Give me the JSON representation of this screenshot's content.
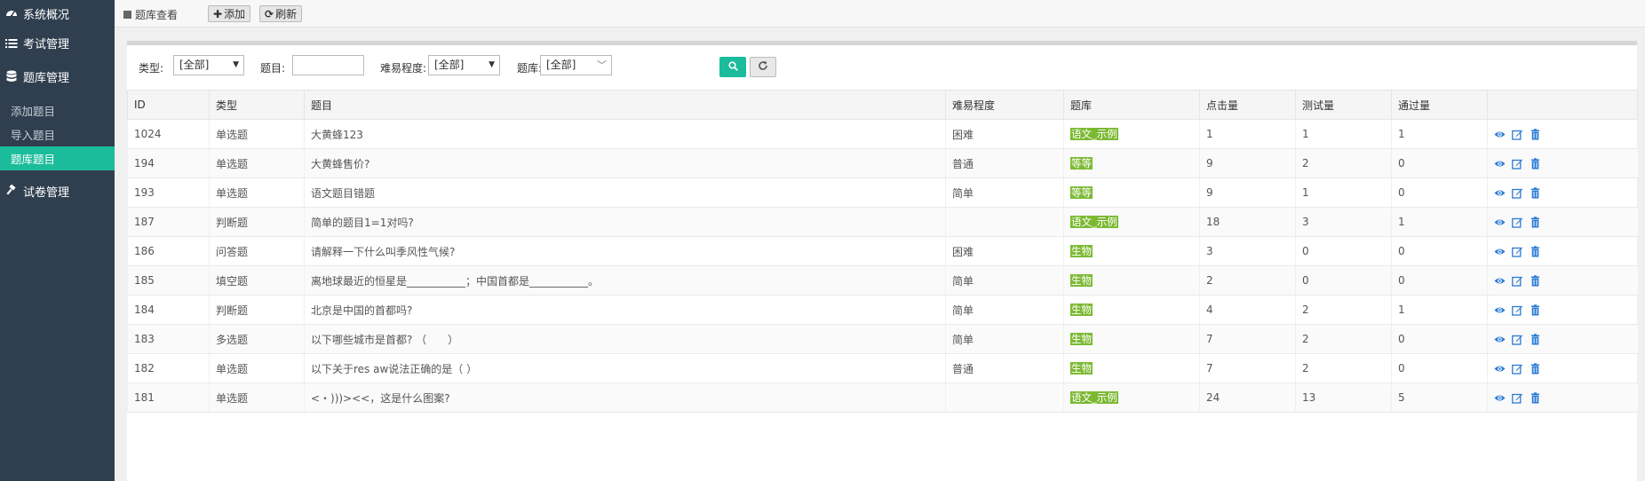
{
  "sidebar": {
    "items": [
      {
        "label": "系统概况",
        "icon": "dashboard-icon"
      },
      {
        "label": "考试管理",
        "icon": "list-icon"
      },
      {
        "label": "题库管理",
        "icon": "database-icon"
      },
      {
        "label": "试卷管理",
        "icon": "gavel-icon"
      }
    ],
    "sub_items": [
      {
        "label": "添加题目",
        "active": false
      },
      {
        "label": "导入题目",
        "active": false
      },
      {
        "label": "题库题目",
        "active": true
      }
    ],
    "background": "#2f3f4f",
    "accent": "#1bbc9b"
  },
  "topbar": {
    "breadcrumb": "题库查看",
    "add_label": "添加",
    "refresh_label": "刷新"
  },
  "filter": {
    "type_label": "类型:",
    "type_value": "[全部]",
    "title_label": "题目:",
    "title_value": "",
    "difficulty_label": "难易程度:",
    "difficulty_value": "[全部]",
    "bank_label": "题库:",
    "bank_value": "[全部]"
  },
  "table": {
    "headers": [
      "ID",
      "类型",
      "题目",
      "难易程度",
      "题库",
      "点击量",
      "测试量",
      "通过量",
      ""
    ],
    "rows": [
      {
        "id": "1024",
        "type": "单选题",
        "title": "大黄蜂123",
        "difficulty": "困难",
        "bank": "语文_示例",
        "clicks": "1",
        "tests": "1",
        "passes": "1"
      },
      {
        "id": "194",
        "type": "单选题",
        "title": "大黄蜂售价?",
        "difficulty": "普通",
        "bank": "等等",
        "clicks": "9",
        "tests": "2",
        "passes": "0"
      },
      {
        "id": "193",
        "type": "单选题",
        "title": "语文题目错题",
        "difficulty": "简单",
        "bank": "等等",
        "clicks": "9",
        "tests": "1",
        "passes": "0"
      },
      {
        "id": "187",
        "type": "判断题",
        "title": "简单的题目1=1对吗?",
        "difficulty": "",
        "bank": "语文_示例",
        "clicks": "18",
        "tests": "3",
        "passes": "1"
      },
      {
        "id": "186",
        "type": "问答题",
        "title": "请解释一下什么叫季风性气候?",
        "difficulty": "困难",
        "bank": "生物",
        "clicks": "3",
        "tests": "0",
        "passes": "0"
      },
      {
        "id": "185",
        "type": "填空题",
        "title": "离地球最近的恒星是___________；中国首都是___________。",
        "difficulty": "简单",
        "bank": "生物",
        "clicks": "2",
        "tests": "0",
        "passes": "0"
      },
      {
        "id": "184",
        "type": "判断题",
        "title": "北京是中国的首都吗?",
        "difficulty": "简单",
        "bank": "生物",
        "clicks": "4",
        "tests": "2",
        "passes": "1"
      },
      {
        "id": "183",
        "type": "多选题",
        "title": "以下哪些城市是首都? （　　）",
        "difficulty": "简单",
        "bank": "生物",
        "clicks": "7",
        "tests": "2",
        "passes": "0"
      },
      {
        "id": "182",
        "type": "单选题",
        "title": "以下关于res aw说法正确的是（ ）",
        "difficulty": "普通",
        "bank": "生物",
        "clicks": "7",
        "tests": "2",
        "passes": "0"
      },
      {
        "id": "181",
        "type": "单选题",
        "title": "<・)))><<，这是什么图案?",
        "difficulty": "",
        "bank": "语文_示例",
        "clicks": "24",
        "tests": "13",
        "passes": "5"
      }
    ],
    "tag_color": "#7cb933",
    "action_color": "#2a7bd4"
  }
}
